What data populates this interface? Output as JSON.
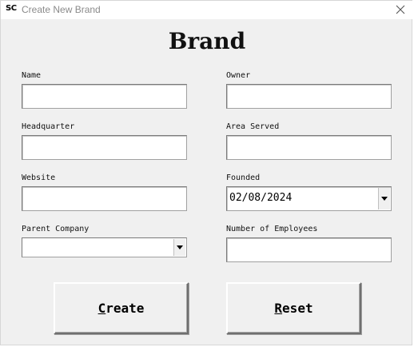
{
  "window": {
    "app_icon": "SC",
    "title": "Create New Brand"
  },
  "icons": {
    "close": "close-icon",
    "dropdown": "chevron-down-icon"
  },
  "heading": "Brand",
  "fields": {
    "name": {
      "label": "Name",
      "value": ""
    },
    "owner": {
      "label": "Owner",
      "value": ""
    },
    "headquarter": {
      "label": "Headquarter",
      "value": ""
    },
    "area_served": {
      "label": "Area Served",
      "value": ""
    },
    "website": {
      "label": "Website",
      "value": ""
    },
    "founded": {
      "label": "Founded",
      "value": "02/08/2024"
    },
    "parent_company": {
      "label": "Parent Company",
      "value": ""
    },
    "employees": {
      "label": "Number of Employees",
      "value": ""
    }
  },
  "buttons": {
    "create": {
      "accel": "C",
      "rest": "reate"
    },
    "reset": {
      "accel": "R",
      "rest": "eset"
    }
  }
}
